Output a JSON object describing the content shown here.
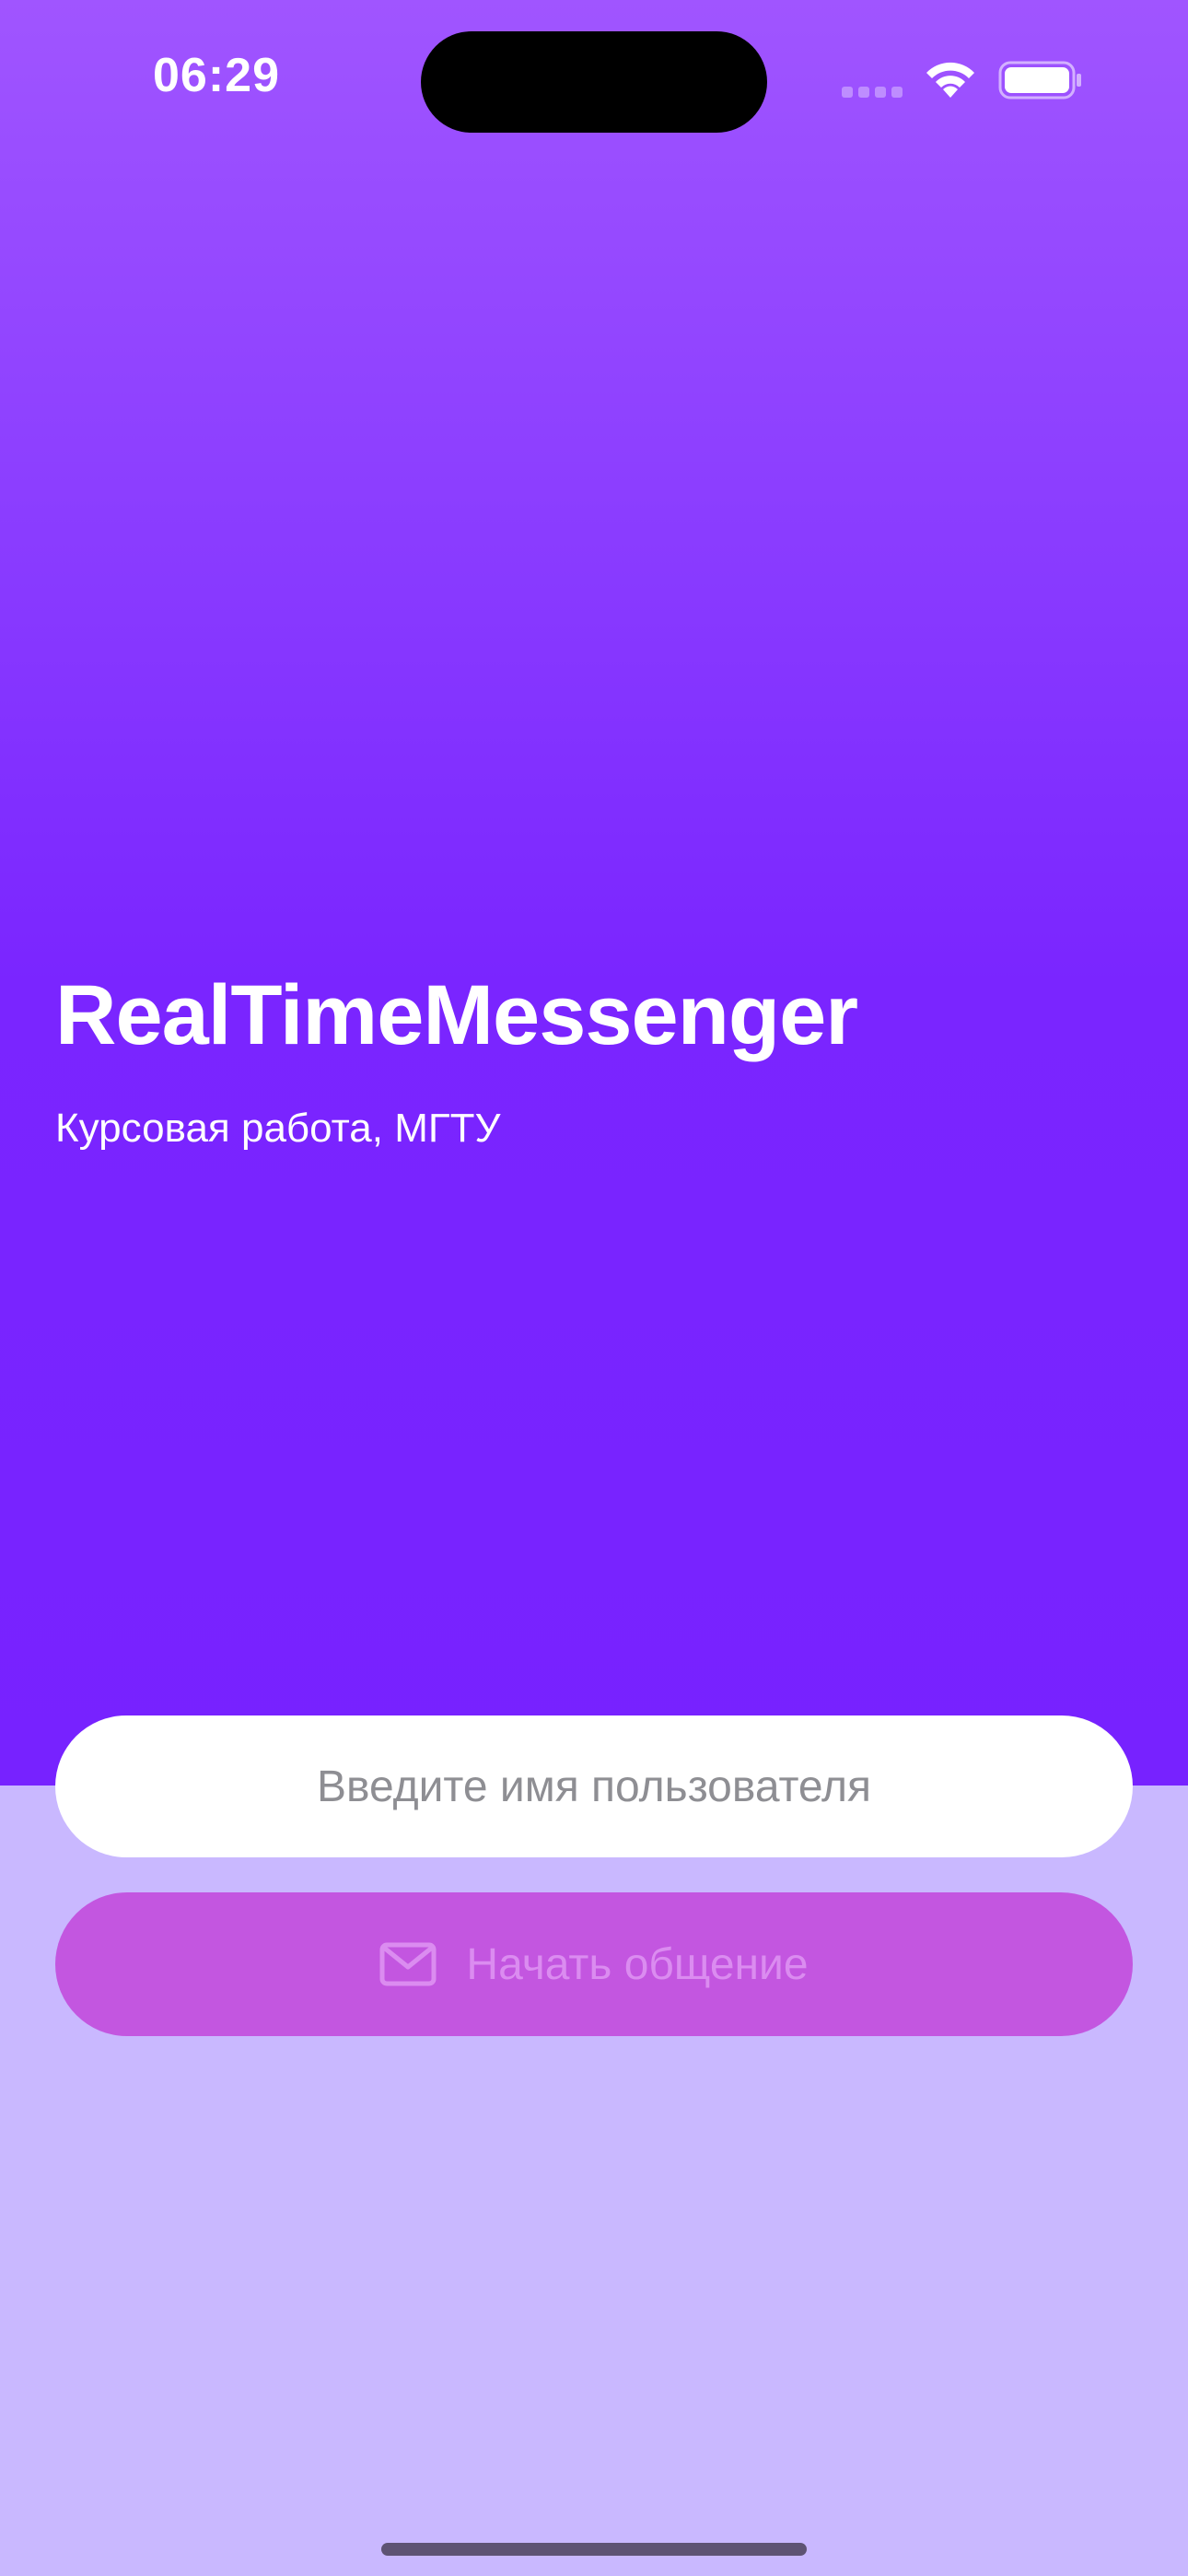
{
  "status_bar": {
    "time": "06:29",
    "icons": [
      "signal-icon",
      "wifi-icon",
      "battery-icon"
    ]
  },
  "app": {
    "title": "RealTimeMessenger",
    "subtitle": "Курсовая работа, МГТУ"
  },
  "login": {
    "username_placeholder": "Введите имя пользователя",
    "username_value": "",
    "start_button_label": "Начать общение",
    "start_button_icon": "envelope-icon"
  },
  "colors": {
    "gradient_top": "#a055ff",
    "gradient_bottom": "#7722ff",
    "background_light": "#c9b8ff",
    "button_fill": "#c356e0",
    "button_text": "#db8cf0"
  }
}
